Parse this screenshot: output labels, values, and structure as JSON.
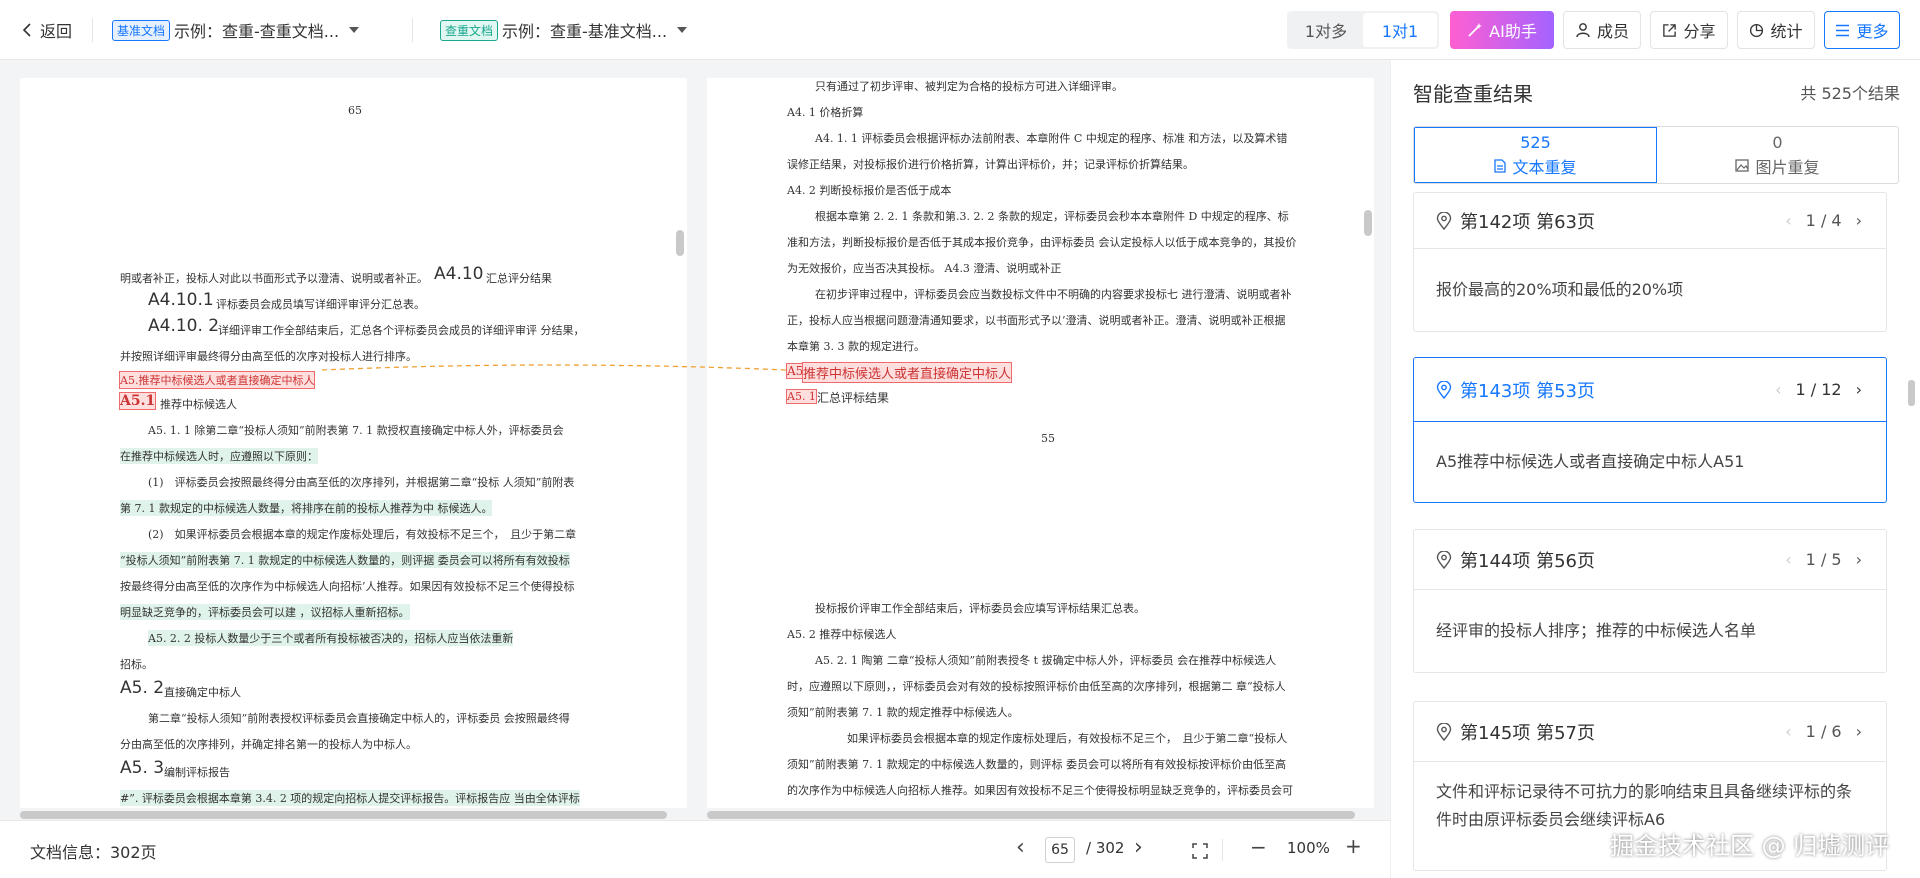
{
  "header": {
    "back_label": "返回",
    "base_tag": "基准文档",
    "base_doc": "示例：查重-查重文档...",
    "check_tag": "查重文档",
    "check_doc": "示例：查重-基准文档...",
    "mode_many": "1对多",
    "mode_one": "1对1",
    "ai_label": "AI助手",
    "members_label": "成员",
    "share_label": "分享",
    "stats_label": "统计",
    "more_label": "更多"
  },
  "left_page": {
    "page_number": "65",
    "lines": [
      "明或者补正，投标人对此以书面形式予以澄清、说明或者补正。",
      "A4.10",
      "汇总评分结果",
      "A4.10.1",
      "评标委员会成员填写详细评审评分汇总表。",
      "A4.10. 2",
      "详细评审工作全部结束后，汇总各个评标委员会成员的详细评审评 分结果，",
      "并按照详细评审最终得分由高至低的次序对投标人进行排序。",
      "A5.推荐中标候选人或者直接确定中标人",
      "A5.1",
      "推荐中标候选人",
      "A5. 1. 1 除第二章“投标人须知”前附表第 7. 1 款授权直接确定中标人外，评标委员会",
      "在推荐中标候选人时，应遵照以下原则：",
      "(1)　评标委员会按照最终得分由高至低的次序排列，并根据第二章“投标 人须知”前附表",
      "第 7. 1 款规定的中标候选人数量，将排序在前的投标人推荐为中 标候选人。",
      "(2)　如果评标委员会根据本章的规定作废标处理后，有效投标不足三个，　且少于第二章",
      "“投标人须知”前附表第 7. 1 款规定的中标候选人数量的，则评据 委员会可以将所有有效投标",
      "按最终得分由高至低的次序作为中标候选人向招标’人推荐。如果因有效投标不足三个使得投标",
      "明显缺乏竞争的，评标委员会可以建 ，议招标人重新招标。",
      "A5. 2. 2 投标人数量少于三个或者所有投标被否决的，招标人应当依法重新",
      "招标。",
      "A5. 2",
      "直接确定中标人",
      "第二章“投标人须知”前附表授权评标委员会直接确定中标人的，评标委员 会按照最终得",
      "分由高至低的次序排列，并确定排名第一的投标人为中标人。",
      "A5. 3",
      "编制评标报告",
      "#”. 评标委员会根据本章第 3.4. 2 项的规定向招标人提交评标报告。评标报告应 当由全体评标"
    ]
  },
  "right_page": {
    "page_number": "55",
    "lines": [
      "只有通过了初步评审、被判定为合格的投标方可进入详细评审。",
      "A4. 1 价格折算",
      "A4. 1. 1 评标委员会根据评标办法前附表、本章附件 C 中规定的程序、标准 和方法，以及算术错",
      "误修正结果，对投标报价进行价格折算，计算出评标价，并；记录评标价折算结果。",
      "A4. 2 判断投标报价是否低于成本",
      "根据本章第 2. 2. 1 条款和第.3. 2. 2 条款的规定，评标委员会秒本本章附件 D 中规定的程序、标",
      "准和方法，判断投标报价是否低于其成本报价竞争，由评标委员 会认定投标人以低于成本竞争的，其投价",
      "为无效报价，应当否决其投标。 A4.3 澄清、说明或补正",
      "在初步评审过程中，评标委员会应当数投标文件中不明确的内容要求投标七 进行澄清、说明或者补",
      "正，投标人应当根据问题澄清通知要求，以书面形式予以’澄清、说明或者补正。澄清、说明或补正根据",
      "本章第 3. 3 款的规定进行。",
      "A5",
      "推荐中标候选人或者直接确定中标人",
      "A5. 1",
      "汇总评标结果",
      "投标报价评审工作全部结束后，评标委员会应填写评标结果汇总表。",
      "A5. 2 推荐中标候选人",
      "A5. 2. 1 陶第 二章“投标人须知”前附表授冬 t 拔确定中标人外，评标委员 会在推荐中标候选人",
      "时，应遵照以下原则，，评标委员会对有效的投标按照评标价由低至高的次序排列，根据第二 章“投标人",
      "须知”前附表第 7. 1 款的规定推荐中标候选人。",
      "如果评标委员会根据本章的规定作废标处理后，有效投标不足三个，　且少于第二章“投标人",
      "须知”前附表第 7. 1 款规定的中标候选人数量的，则评标 委员会可以将所有有效投标按评标价由低至高",
      "的次序作为中标候选人向招标人推荐。如果因有效投标不足三个使得投标明显缺乏竞争的，评标委员会可"
    ]
  },
  "footer": {
    "doc_info": "文档信息：302页",
    "current_page": "65",
    "total_pages": "/ 302",
    "zoom": "100%",
    "prev_icon": "‹",
    "next_icon": "›",
    "minus": "−",
    "plus": "+"
  },
  "results": {
    "title": "智能查重结果",
    "total": "共 525个结果",
    "tab_text_count": "525",
    "tab_text_label": "文本重复",
    "tab_image_count": "0",
    "tab_image_label": "图片重复",
    "items": [
      {
        "title": "第142项 第63页",
        "nav": "1 / 4",
        "body": "报价最高的20%项和最低的20%项"
      },
      {
        "title": "第143项 第53页",
        "nav": "1 / 12",
        "body": "A5推荐中标候选人或者直接确定中标人A51"
      },
      {
        "title": "第144项 第56页",
        "nav": "1 / 5",
        "body": "经评审的投标人排序；推荐的中标候选人名单"
      },
      {
        "title": "第145项 第57页",
        "nav": "1 / 6",
        "body": "文件和评标记录待不可抗力的影响结束且具备继续评标的条件时由原评标委员会继续评标A6"
      }
    ]
  },
  "watermark": "掘金技术社区 @ 归墟测评",
  "colors": {
    "accent": "#1677ff",
    "highlight_red": "#ef6b6b",
    "highlight_green": "#e0f3ea",
    "ai_gradient_start": "#ff5fd2",
    "ai_gradient_end": "#a463ff"
  }
}
